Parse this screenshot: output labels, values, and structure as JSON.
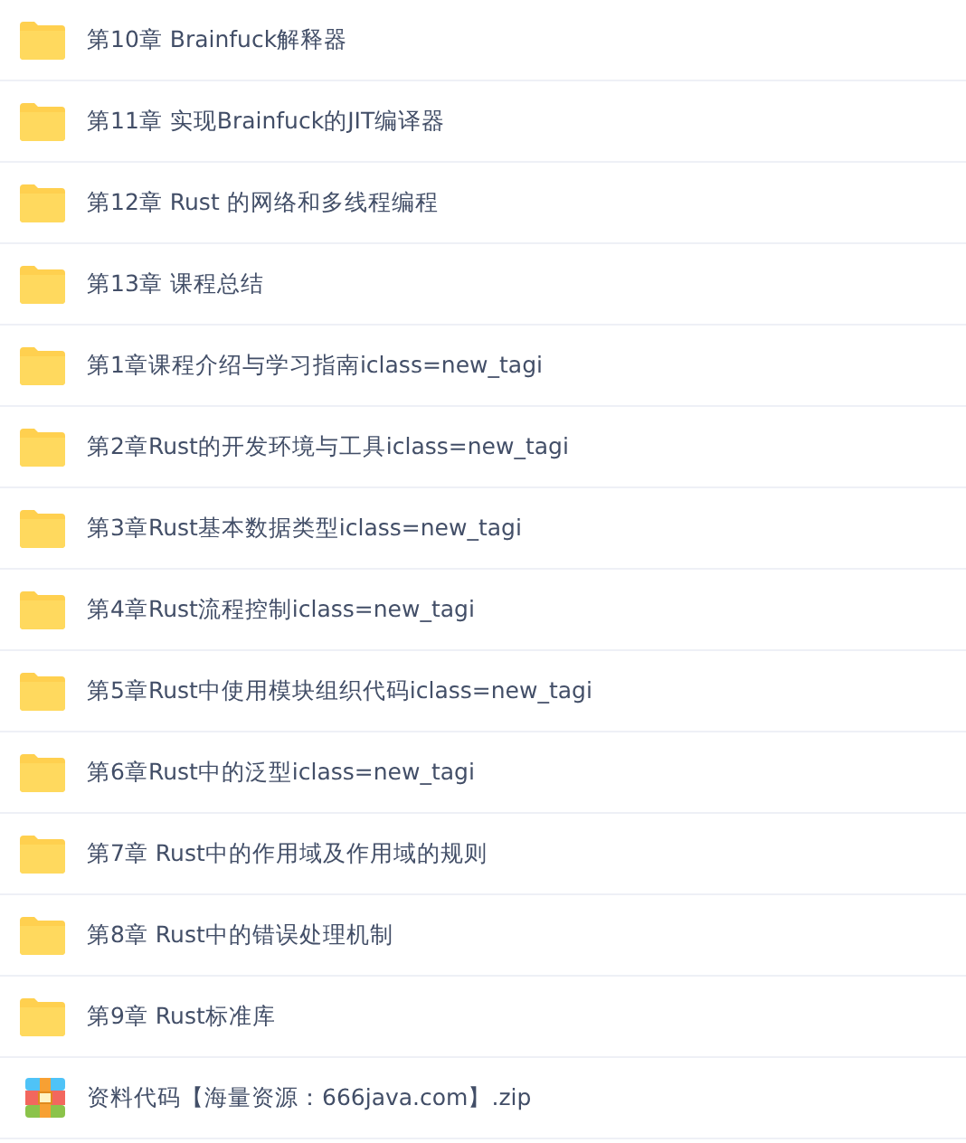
{
  "files": [
    {
      "kind": "folder",
      "name": "第10章 Brainfuck解释器"
    },
    {
      "kind": "folder",
      "name": "第11章 实现Brainfuck的JIT编译器"
    },
    {
      "kind": "folder",
      "name": "第12章 Rust 的网络和多线程编程"
    },
    {
      "kind": "folder",
      "name": "第13章 课程总结"
    },
    {
      "kind": "folder",
      "name": "第1章课程介绍与学习指南iclass=new_tagi"
    },
    {
      "kind": "folder",
      "name": "第2章Rust的开发环境与工具iclass=new_tagi"
    },
    {
      "kind": "folder",
      "name": "第3章Rust基本数据类型iclass=new_tagi"
    },
    {
      "kind": "folder",
      "name": "第4章Rust流程控制iclass=new_tagi"
    },
    {
      "kind": "folder",
      "name": "第5章Rust中使用模块组织代码iclass=new_tagi"
    },
    {
      "kind": "folder",
      "name": "第6章Rust中的泛型iclass=new_tagi"
    },
    {
      "kind": "folder",
      "name": "第7章 Rust中的作用域及作用域的规则"
    },
    {
      "kind": "folder",
      "name": "第8章 Rust中的错误处理机制"
    },
    {
      "kind": "folder",
      "name": "第9章 Rust标准库"
    },
    {
      "kind": "archive",
      "name": "资料代码【海量资源：666java.com】.zip"
    }
  ]
}
